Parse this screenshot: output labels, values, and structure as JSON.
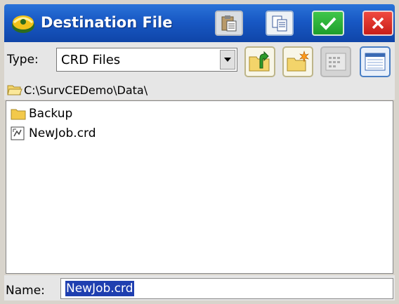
{
  "window": {
    "title": "Destination File"
  },
  "title_buttons": {
    "paste_icon": "paste-icon",
    "copy_icon": "copy-icon",
    "ok_icon": "checkmark-icon",
    "close_icon": "close-icon"
  },
  "toolbar": {
    "type_label": "Type:",
    "type_value": "CRD Files",
    "buttons": [
      "folder-up-icon",
      "new-folder-icon",
      "list-view-icon",
      "details-view-icon"
    ]
  },
  "path": {
    "current": "C:\\SurvCEDemo\\Data\\"
  },
  "files": [
    {
      "name": "Backup",
      "kind": "folder"
    },
    {
      "name": "NewJob.crd",
      "kind": "file"
    }
  ],
  "name_field": {
    "label": "Name:",
    "value": "NewJob.crd"
  },
  "colors": {
    "titlebar": "#1858c4",
    "ok": "#2bb038",
    "close": "#d92a22",
    "selection": "#1f3fb0"
  }
}
